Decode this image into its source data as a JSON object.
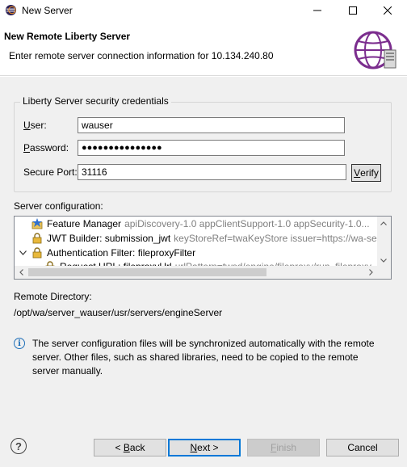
{
  "window": {
    "title": "New Server"
  },
  "header": {
    "title": "New Remote Liberty Server",
    "description": "Enter remote server connection information for 10.134.240.80"
  },
  "credentials": {
    "group_label": "Liberty Server security credentials",
    "user_label": "User:",
    "user_value": "wauser",
    "password_label": "Password:",
    "password_value": "●●●●●●●●●●●●●●●",
    "port_label": "Secure Port:",
    "port_value": "31116",
    "verify_label": "Verify"
  },
  "server_config": {
    "label": "Server configuration:",
    "rows": [
      {
        "name": "Feature Manager",
        "detail": "apiDiscovery-1.0 appClientSupport-1.0 appSecurity-1.0...",
        "icon": "feature-manager-icon"
      },
      {
        "name": "JWT Builder: submission_jwt",
        "detail": "keyStoreRef=twaKeyStore issuer=https://wa-server",
        "icon": "lock-icon"
      },
      {
        "name": "Authentication Filter: fileproxyFilter",
        "detail": "",
        "icon": "lock-icon",
        "expanded": true
      },
      {
        "name": "Request URL: fileproxyUrl",
        "detail": "urlPattern=twsd/engine/fileproxy/run_fileproxy",
        "icon": "lock-icon"
      }
    ]
  },
  "remote_directory": {
    "label": "Remote Directory:",
    "value": "/opt/wa/server_wauser/usr/servers/engineServer"
  },
  "info": {
    "text": "The server configuration files will be synchronized automatically with the remote server.  Other files, such as shared libraries, need to be copied to the remote server manually."
  },
  "footer": {
    "back_label": "< Back",
    "next_label": "Next >",
    "finish_label": "Finish",
    "cancel_label": "Cancel"
  }
}
